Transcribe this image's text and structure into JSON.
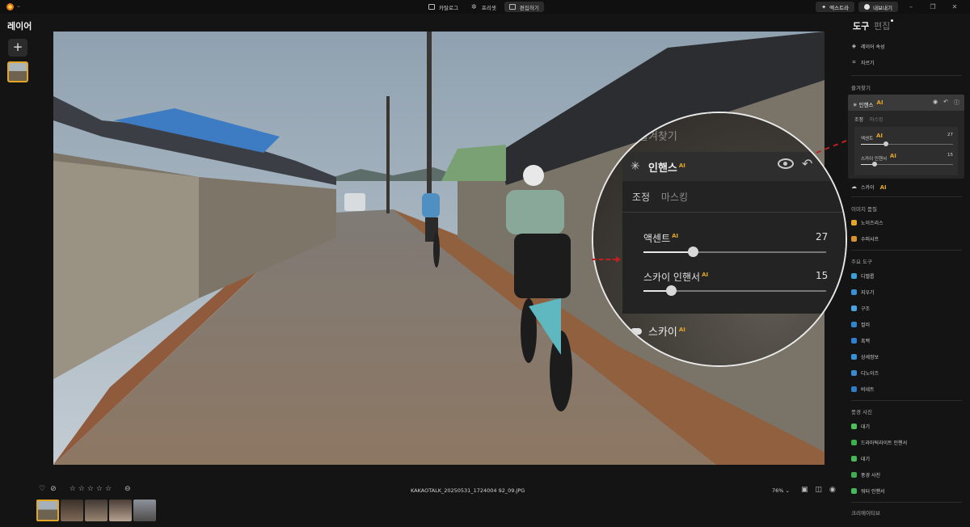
{
  "titlebar": {
    "tabs": [
      {
        "label": "카탈로그",
        "icon": "catalog-icon"
      },
      {
        "label": "프리셋",
        "icon": "preset-sparkle-icon"
      },
      {
        "label": "편집하기",
        "icon": "edit-sliders-icon"
      }
    ],
    "extra_button": "엑스트라",
    "export_button": "내보내기"
  },
  "left_panel": {
    "title": "레이어",
    "add_symbol": "+"
  },
  "magnifier": {
    "top_text": "즐겨찾기",
    "enhance_label": "인핸스",
    "ai_badge": "AI",
    "tab_adjust": "조정",
    "tab_mask": "마스킹",
    "sliders": [
      {
        "label": "액센트",
        "value": "27",
        "fraction": 0.27
      },
      {
        "label": "스카이 인핸서",
        "value": "15",
        "fraction": 0.15
      }
    ],
    "sky_label": "스카이"
  },
  "bottom": {
    "filename": "KAKAOTALK_20250531_1724004 92_09.JPG",
    "zoom": "76%",
    "rating": 0
  },
  "right_panel": {
    "tab_tools": "도구",
    "tab_edit": "편집",
    "layer_props": "레이어 속성",
    "crop": "자르기",
    "favorites_title": "즐겨찾기",
    "enhance": "인핸스",
    "ai_badge": "AI",
    "tab_adjust": "조정",
    "tab_mask": "마스킹",
    "sliders": [
      {
        "label": "액센트",
        "value": "27",
        "fraction": 0.27
      },
      {
        "label": "스카이 인핸서",
        "value": "15",
        "fraction": 0.15
      }
    ],
    "sky": "스카이",
    "image_quality_title": "이미지 품질",
    "noiseless": "노이즈리스",
    "supersharp": "수퍼샤프",
    "main_tools_title": "주요 도구",
    "develop": "디벨롭",
    "erase": "지우기",
    "structure": "구조",
    "color": "컬러",
    "bw": "흑백",
    "details": "상세정보",
    "denoise": "디노이즈",
    "vignette": "비네트",
    "landscape_title": "풍경 사진",
    "atmosphere": "대기",
    "dramatic_light": "드라마틱라이트 인핸서",
    "golden_hour": "대기",
    "landscape": "풍경 사진",
    "water": "워터 인핸서",
    "creative_title": "크리에이티브"
  }
}
